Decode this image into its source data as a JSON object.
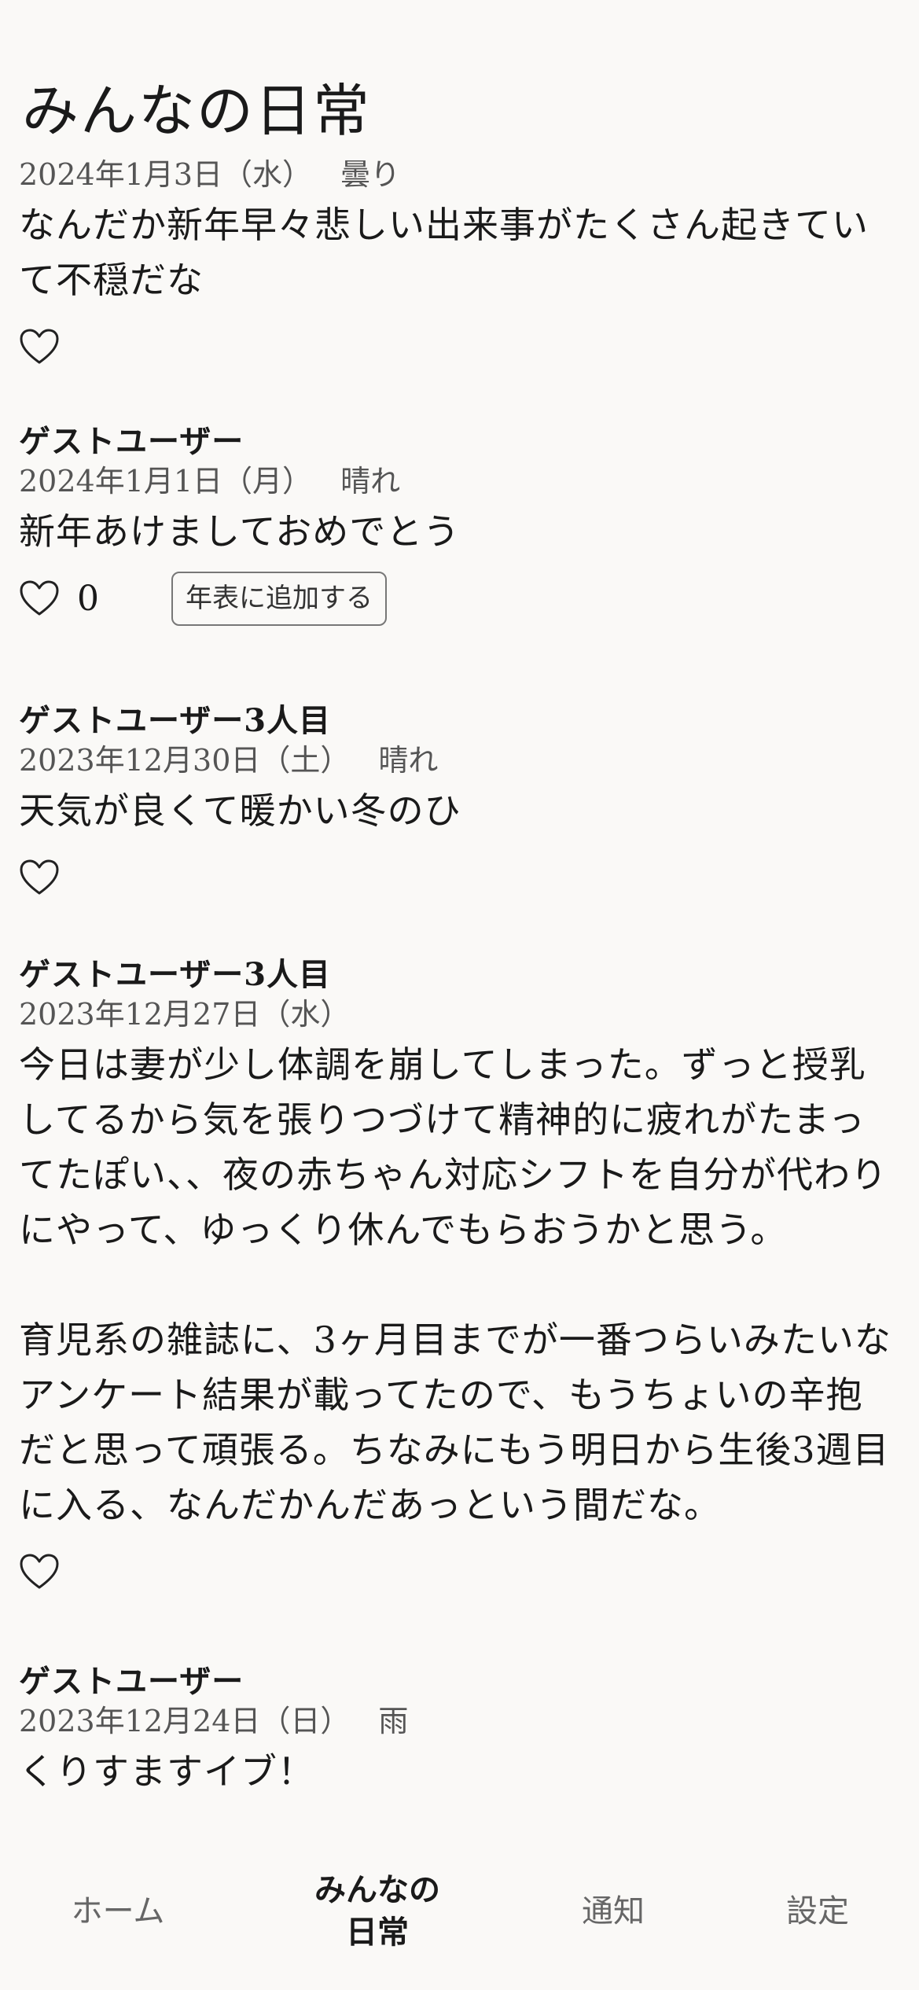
{
  "page": {
    "title": "みんなの日常"
  },
  "posts": [
    {
      "author": "",
      "date": "2024年1月3日（水）",
      "weather": "曇り",
      "body": "なんだか新年早々悲しい出来事がたくさん起きていて不穏だな",
      "likes": "",
      "button": ""
    },
    {
      "author": "ゲストユーザー",
      "date": "2024年1月1日（月）",
      "weather": "晴れ",
      "body": "新年あけましておめでとう",
      "likes": "0",
      "button": "年表に追加する"
    },
    {
      "author": "ゲストユーザー3人目",
      "date": "2023年12月30日（土）",
      "weather": "晴れ",
      "body": "天気が良くて暖かい冬のひ",
      "likes": "",
      "button": ""
    },
    {
      "author": "ゲストユーザー3人目",
      "date": "2023年12月27日（水）",
      "weather": "",
      "body": "今日は妻が少し体調を崩してしまった。ずっと授乳してるから気を張りつづけて精神的に疲れがたまってたぽい、、夜の赤ちゃん対応シフトを自分が代わりにやって、ゆっくり休んでもらおうかと思う。\n\n育児系の雑誌に、3ヶ月目までが一番つらいみたいなアンケート結果が載ってたので、もうちょいの辛抱だと思って頑張る。ちなみにもう明日から生後3週目に入る、なんだかんだあっという間だな。",
      "likes": "",
      "button": ""
    },
    {
      "author": "ゲストユーザー",
      "date": "2023年12月24日（日）",
      "weather": "雨",
      "body": "くりすますイブ！",
      "likes": "",
      "button": ""
    }
  ],
  "tabs": [
    {
      "label": "ホーム"
    },
    {
      "label": "みんなの\n日常"
    },
    {
      "label": "通知"
    },
    {
      "label": "設定"
    }
  ],
  "icons": {
    "like": "heart-outline-icon"
  },
  "colors": {
    "background": "#faf9f7",
    "text": "#1a1a1a",
    "muted": "#555555"
  }
}
